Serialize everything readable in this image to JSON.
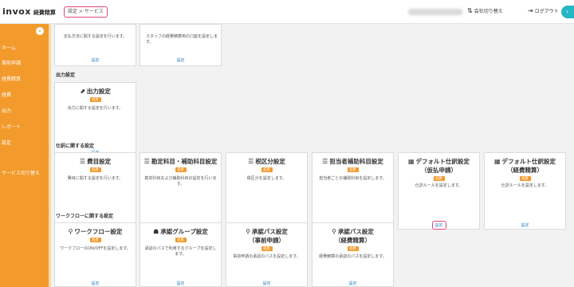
{
  "header": {
    "logo": "invox",
    "logo_sub": "経費精算",
    "breadcrumb": "設定 > サービス",
    "switch_company": "会社切り替え",
    "logout": "ログアウト"
  },
  "sidebar": {
    "items": [
      "ホーム",
      "事前申請",
      "経費精算",
      "経費",
      "出力",
      "レポート",
      "設定",
      "サービス切り替え"
    ]
  },
  "sections": {
    "output": "出力設定",
    "journal": "仕訳に関する設定",
    "workflow": "ワークフローに関する設定"
  },
  "badge_label": "経費",
  "link_label": "設定",
  "cards": {
    "payment": {
      "desc": "支払方法に関する設定を行います。"
    },
    "staff": {
      "desc": "スタッフの経費精算用の口座を設定します。"
    },
    "output": {
      "title": "出力設定",
      "desc": "出力に関する設定を行います。"
    },
    "cost": {
      "title": "費目設定",
      "desc": "費目に関する設定を行います。"
    },
    "account": {
      "title": "勘定科目・補助科目設定",
      "desc": "勘定科目および補助科目の設定を行います。"
    },
    "tax": {
      "title": "税区分設定",
      "desc": "税区分を設定します。"
    },
    "person": {
      "title": "担当者補助科目設定",
      "desc": "担当者ごとの補助科目を設定します。"
    },
    "default_pre": {
      "title1": "デフォルト仕訳設定",
      "title2": "（仮払申請）",
      "desc": "仕訳ルールを設定します。"
    },
    "default_exp": {
      "title1": "デフォルト仕訳設定",
      "title2": "（経費精算）",
      "desc": "仕訳ルールを設定します。"
    },
    "workflow": {
      "title": "ワークフロー設定",
      "desc": "ワークフローのON/OFFを設定します。"
    },
    "approval_group": {
      "title": "承認グループ設定",
      "desc": "承認のパスで利用するグループを設定します。"
    },
    "approval_pre": {
      "title1": "承認パス設定",
      "title2": "（事前申請）",
      "desc": "事前申請の承認のパスを設定します。"
    },
    "approval_exp": {
      "title1": "承認パス設定",
      "title2": "（経費精算）",
      "desc": "経費精算の承認のパスを設定します。"
    }
  },
  "icons": {
    "output": "export-icon",
    "list": "list-icon",
    "calendar": "calendar-icon",
    "workflow": "workflow-icon",
    "group": "group-icon",
    "path": "path-icon",
    "switch": "switch-icon",
    "logout": "logout-icon"
  },
  "colors": {
    "sidebar": "#f39a2c",
    "badge": "#f39a2c",
    "link": "#2a7fc1",
    "highlight": "#e0457b",
    "accent": "#26b6c6"
  }
}
